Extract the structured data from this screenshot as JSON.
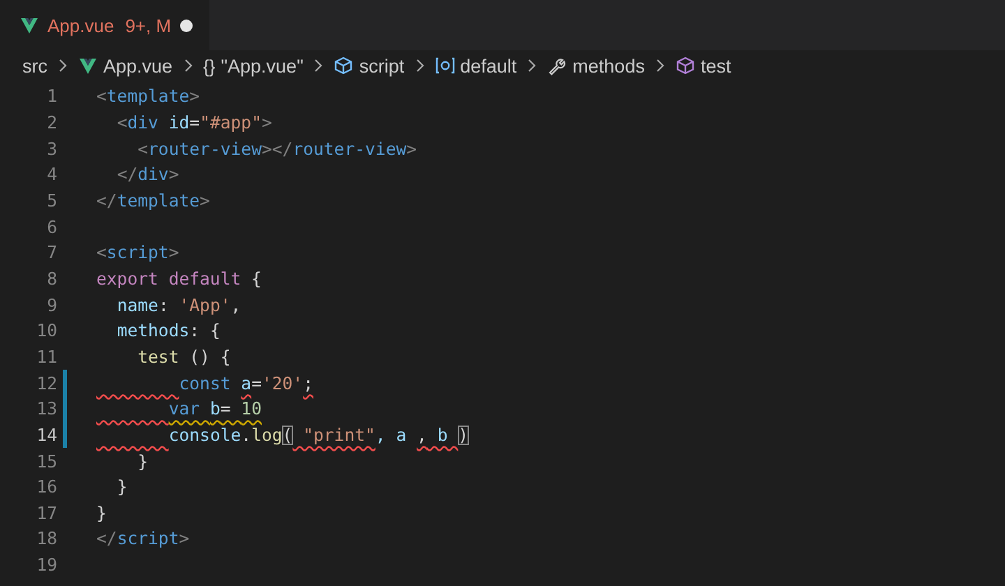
{
  "tab": {
    "filename": "App.vue",
    "problems": "9+, M",
    "dirty": true,
    "selected": true
  },
  "breadcrumbs": [
    {
      "label": "src",
      "kind": "folder"
    },
    {
      "label": "App.vue",
      "kind": "vue"
    },
    {
      "label": "\"App.vue\"",
      "kind": "braces",
      "glyph": "{}"
    },
    {
      "label": "script",
      "kind": "module"
    },
    {
      "label": "default",
      "kind": "variable"
    },
    {
      "label": "methods",
      "kind": "wrench"
    },
    {
      "label": "test",
      "kind": "method"
    }
  ],
  "lines": [
    {
      "number": "1",
      "modified": false,
      "current": false,
      "indent_error": false,
      "tokens": [
        {
          "text": "<",
          "kind": "bracket"
        },
        {
          "text": "template",
          "kind": "tag"
        },
        {
          "text": ">",
          "kind": "bracket"
        }
      ]
    },
    {
      "number": "2",
      "modified": false,
      "current": false,
      "indent_error": false,
      "tokens": [
        {
          "text": "  <",
          "kind": "bracket"
        },
        {
          "text": "div ",
          "kind": "tag"
        },
        {
          "text": "id",
          "kind": "attr"
        },
        {
          "text": "=",
          "kind": "plain"
        },
        {
          "text": "\"#app\"",
          "kind": "string"
        },
        {
          "text": ">",
          "kind": "bracket"
        }
      ]
    },
    {
      "number": "3",
      "modified": false,
      "current": false,
      "indent_error": false,
      "tokens": [
        {
          "text": "    <",
          "kind": "bracket"
        },
        {
          "text": "router-view",
          "kind": "tag"
        },
        {
          "text": "></",
          "kind": "bracket"
        },
        {
          "text": "router-view",
          "kind": "tag"
        },
        {
          "text": ">",
          "kind": "bracket"
        }
      ]
    },
    {
      "number": "4",
      "modified": false,
      "current": false,
      "indent_error": false,
      "tokens": [
        {
          "text": "  </",
          "kind": "bracket"
        },
        {
          "text": "div",
          "kind": "tag"
        },
        {
          "text": ">",
          "kind": "bracket"
        }
      ]
    },
    {
      "number": "5",
      "modified": false,
      "current": false,
      "indent_error": false,
      "tokens": [
        {
          "text": "</",
          "kind": "bracket"
        },
        {
          "text": "template",
          "kind": "tag"
        },
        {
          "text": ">",
          "kind": "bracket"
        }
      ]
    },
    {
      "number": "6",
      "modified": false,
      "current": false,
      "indent_error": false
    },
    {
      "number": "7",
      "modified": false,
      "current": false,
      "indent_error": false,
      "tokens": [
        {
          "text": "<",
          "kind": "bracket"
        },
        {
          "text": "script",
          "kind": "tag"
        },
        {
          "text": ">",
          "kind": "bracket"
        }
      ]
    },
    {
      "number": "8",
      "modified": false,
      "current": false,
      "indent_error": false,
      "tokens": [
        {
          "text": "export default",
          "kind": "control"
        },
        {
          "text": " {",
          "kind": "plain"
        }
      ]
    },
    {
      "number": "9",
      "modified": false,
      "current": false,
      "indent_error": false,
      "tokens": [
        {
          "text": "  name",
          "kind": "property"
        },
        {
          "text": ": ",
          "kind": "plain"
        },
        {
          "text": "'App'",
          "kind": "string"
        },
        {
          "text": ",",
          "kind": "plain"
        }
      ]
    },
    {
      "number": "10",
      "modified": false,
      "current": false,
      "indent_error": false,
      "tokens": [
        {
          "text": "  methods",
          "kind": "property"
        },
        {
          "text": ": {",
          "kind": "plain"
        }
      ]
    },
    {
      "number": "11",
      "modified": false,
      "current": false,
      "indent_error": false,
      "tokens": [
        {
          "text": "    test",
          "kind": "function"
        },
        {
          "text": " () {",
          "kind": "plain"
        }
      ]
    },
    {
      "number": "12",
      "modified": true,
      "current": false,
      "indent_error": true,
      "tokens": [
        {
          "text": "        const ",
          "kind": "keyword"
        },
        {
          "text": "a",
          "kind": "variable",
          "error": true
        },
        {
          "text": "=",
          "kind": "plain"
        },
        {
          "text": "'20'",
          "kind": "string"
        },
        {
          "text": ";",
          "kind": "plain",
          "error": true
        }
      ]
    },
    {
      "number": "13",
      "modified": true,
      "current": false,
      "indent_error": true,
      "tokens": [
        {
          "text": "       var ",
          "kind": "keyword",
          "warning": true
        },
        {
          "text": "b",
          "kind": "variable",
          "warning": true
        },
        {
          "text": "= ",
          "kind": "plain",
          "warning": true
        },
        {
          "text": "10",
          "kind": "number",
          "warning": true
        }
      ]
    },
    {
      "number": "14",
      "modified": true,
      "current": true,
      "indent_error": true,
      "tokens": [
        {
          "text": "       console",
          "kind": "variable"
        },
        {
          "text": ".",
          "kind": "plain"
        },
        {
          "text": "log",
          "kind": "function"
        },
        {
          "text": "(",
          "kind": "plain",
          "match": true
        },
        {
          "text": " \"print\"",
          "kind": "string",
          "error": true
        },
        {
          "text": ", a ",
          "kind": "variable"
        },
        {
          "text": ",",
          "kind": "plain",
          "error": true
        },
        {
          "text": " b ",
          "kind": "variable",
          "error": true
        },
        {
          "text": ")",
          "kind": "plain",
          "match": true
        }
      ]
    },
    {
      "number": "15",
      "modified": false,
      "current": false,
      "indent_error": false,
      "tokens": [
        {
          "text": "    }",
          "kind": "plain"
        }
      ]
    },
    {
      "number": "16",
      "modified": false,
      "current": false,
      "indent_error": false,
      "tokens": [
        {
          "text": "  }",
          "kind": "plain"
        }
      ]
    },
    {
      "number": "17",
      "modified": false,
      "current": false,
      "indent_error": false,
      "tokens": [
        {
          "text": "}",
          "kind": "plain"
        }
      ]
    },
    {
      "number": "18",
      "modified": false,
      "current": false,
      "indent_error": false,
      "tokens": [
        {
          "text": "</",
          "kind": "bracket"
        },
        {
          "text": "script",
          "kind": "tag"
        },
        {
          "text": ">",
          "kind": "bracket"
        }
      ]
    },
    {
      "number": "19",
      "modified": false,
      "current": false,
      "indent_error": false
    }
  ]
}
